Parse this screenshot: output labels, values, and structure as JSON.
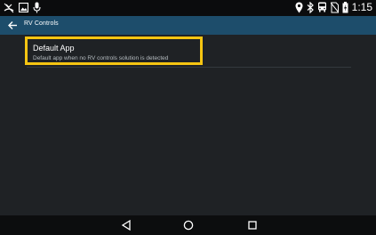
{
  "status_bar": {
    "time": "1:15",
    "left_icons": [
      "missed-call-icon",
      "image-icon",
      "microphone-icon"
    ],
    "right_icons": [
      "location-icon",
      "bluetooth-icon",
      "bus-icon",
      "no-signal-icon",
      "battery-charging-icon"
    ]
  },
  "toolbar": {
    "title": "RV Controls",
    "back_icon": "arrow-left-icon",
    "background": "#1d4d6b"
  },
  "settings": {
    "items": [
      {
        "title": "Default App",
        "subtitle": "Default app when no RV controls solution is detected"
      }
    ]
  },
  "highlight_color": "#f5c512",
  "nav_bar": {
    "buttons": [
      "back-triangle-icon",
      "home-circle-icon",
      "recents-square-icon"
    ]
  }
}
